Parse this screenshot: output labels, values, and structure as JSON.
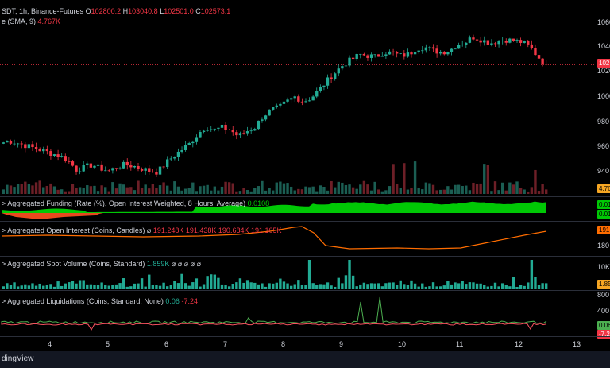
{
  "colors": {
    "up": "#22ab94",
    "down": "#f23645",
    "funding_green": "#00c805",
    "funding_red": "#e8491d",
    "oi": "#ff6d00",
    "liq_green": "#4caf50",
    "liq_red": "#f7525f",
    "volume_up": "#22ab94",
    "volume_down": "#f23645",
    "last_price_line": "#f23645"
  },
  "main_pane": {
    "legend": {
      "symbol": "SDT, 1h, Binance-Futures",
      "ohlc": [
        {
          "k": "O",
          "v": "102800.2"
        },
        {
          "k": "H",
          "v": "103040.8"
        },
        {
          "k": "L",
          "v": "102501.0"
        },
        {
          "k": "C",
          "v": "102573.1"
        }
      ],
      "volume_label": "e (SMA, 9)",
      "volume_value": "4.767K"
    },
    "price_axis": [
      "1060",
      "1040",
      "1020",
      "1000",
      "980",
      "960",
      "940"
    ],
    "last_price_tag": "102",
    "volume_tag": "4.76"
  },
  "panes": [
    {
      "id": "funding",
      "title": "Aggregated Funding (Rate (%), Open Interest Weighted, 8 Hours, Average)",
      "value": "0.0108",
      "value_color": "green",
      "tags": [
        "0.01",
        "0.01"
      ]
    },
    {
      "id": "open_interest",
      "title": "Aggregated Open Interest (Coins, Candles)",
      "values": [
        "⌀",
        "191.248K",
        "191.438K",
        "190.684K",
        "191.105K"
      ],
      "axis": [
        "180"
      ],
      "tags": [
        "191"
      ]
    },
    {
      "id": "spot_volume",
      "title": "Aggregated Spot Volume (Coins, Standard)",
      "value": "1.859K",
      "extras": [
        "⌀",
        "⌀",
        "⌀",
        "⌀",
        "⌀"
      ],
      "axis": [
        "10K"
      ],
      "tags": [
        "1.85"
      ]
    },
    {
      "id": "liquidations",
      "title": "Aggregated Liquidations (Coins, Standard, None)",
      "values": [
        "0.06",
        "-7.24"
      ],
      "axis": [
        "800",
        "400"
      ],
      "tags": [
        "0.06",
        "-7.2"
      ]
    }
  ],
  "time_axis": [
    "4",
    "5",
    "6",
    "7",
    "8",
    "9",
    "10",
    "11",
    "12",
    "13"
  ],
  "footer": {
    "brand": "dingView"
  },
  "chart_data": {
    "type": "candlestick",
    "interval": "1h",
    "x_labels": [
      "4",
      "5",
      "6",
      "7",
      "8",
      "9",
      "10",
      "11",
      "12",
      "13"
    ],
    "price_close_approx": [
      96300,
      96400,
      96200,
      96000,
      95800,
      95600,
      95400,
      95200,
      94800,
      94100,
      94300,
      94500,
      94200,
      94000,
      94300,
      94500,
      94400,
      94200,
      94000,
      93900,
      94600,
      95200,
      95700,
      96200,
      97000,
      97600,
      97300,
      97500,
      97300,
      96800,
      97200,
      97500,
      98400,
      98900,
      99100,
      99600,
      100000,
      99600,
      99900,
      100600,
      101300,
      102000,
      102600,
      103000,
      103400,
      103300,
      103200,
      103600,
      103500,
      103300,
      103400,
      103900,
      104000,
      103700,
      103600,
      103700,
      104200,
      104400,
      104800,
      104600,
      104300,
      104500,
      104600,
      104500,
      104400,
      104000,
      103200,
      102573
    ]
  }
}
